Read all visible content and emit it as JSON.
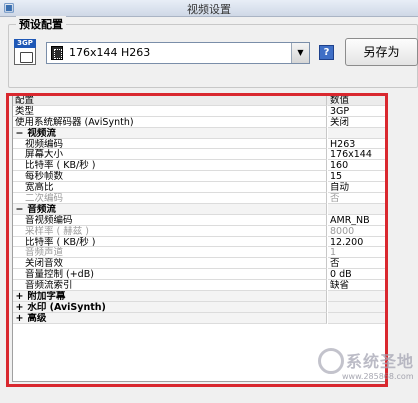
{
  "window": {
    "title": "视频设置"
  },
  "preset": {
    "group_label": "预设配置",
    "icon_tag": "3GP",
    "selected_value": "176x144 H263",
    "help_label": "?",
    "save_as_label": "另存为"
  },
  "grid": {
    "header": {
      "name": "配置",
      "value": "数值"
    },
    "rows": [
      {
        "label": "类型",
        "value": "3GP"
      },
      {
        "label": "使用系统解码器 (AviSynth)",
        "value": "关闭"
      },
      {
        "sign": "−",
        "label": "视频流",
        "value": ""
      },
      {
        "label": "视频编码",
        "value": "H263"
      },
      {
        "label": "屏幕大小",
        "value": "176x144"
      },
      {
        "label": "比特率 ( KB/秒 )",
        "value": "160"
      },
      {
        "label": "每秒帧数",
        "value": "15"
      },
      {
        "label": "宽高比",
        "value": "自动"
      },
      {
        "label": "二次编码",
        "value": "否"
      },
      {
        "sign": "−",
        "label": "音频流",
        "value": ""
      },
      {
        "label": "音视频编码",
        "value": "AMR_NB"
      },
      {
        "label": "采样率 ( 赫兹 )",
        "value": "8000"
      },
      {
        "label": "比特率 ( KB/秒 )",
        "value": "12.200"
      },
      {
        "label": "音频声道",
        "value": "1"
      },
      {
        "label": "关闭音效",
        "value": "否"
      },
      {
        "label": "音量控制 (+dB)",
        "value": "0 dB"
      },
      {
        "label": "音频流索引",
        "value": "缺省"
      },
      {
        "sign": "+",
        "label": "附加字幕",
        "value": ""
      },
      {
        "sign": "+",
        "label": "水印 (AviSynth)",
        "value": ""
      },
      {
        "sign": "+",
        "label": "高级",
        "value": ""
      }
    ]
  },
  "watermark": {
    "text": "系统圣地",
    "url": "www.285868.com"
  },
  "colors": {
    "highlight": "#d9282f",
    "icon_blue": "#1f58b6"
  }
}
